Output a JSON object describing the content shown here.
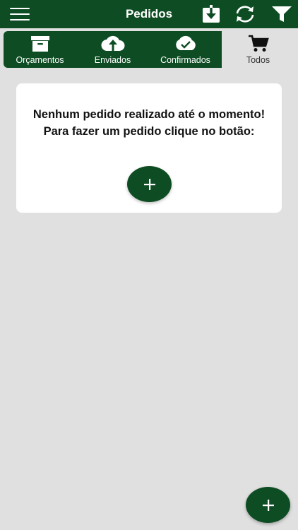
{
  "header": {
    "title": "Pedidos",
    "icons": [
      "menu-icon",
      "download-icon",
      "sync-icon",
      "filter-icon"
    ]
  },
  "tabs": [
    {
      "label": "Orçamentos",
      "icon": "archive-box-icon"
    },
    {
      "label": "Enviados",
      "icon": "cloud-upload-icon"
    },
    {
      "label": "Confirmados",
      "icon": "cloud-check-icon"
    },
    {
      "label": "Todos",
      "icon": "cart-icon"
    }
  ],
  "empty_state": {
    "message": "Nenhum pedido realizado até o momento! Para fazer um pedido clique no botão:",
    "add_icon": "plus-icon"
  },
  "colors": {
    "primary": "#0e4d23",
    "background": "#e0e0e0",
    "card": "#ffffff"
  }
}
